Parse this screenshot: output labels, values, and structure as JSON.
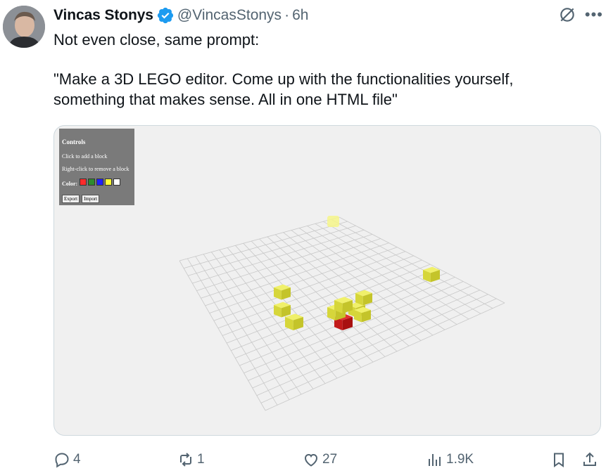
{
  "author": {
    "name": "Vincas Stonys",
    "handle": "@VincasStonys",
    "separator": "·",
    "time": "6h"
  },
  "tweet": {
    "line1": "Not even close, same prompt:",
    "line2": "\"Make a 3D LEGO editor. Come up with the functionalities yourself, something that makes sense. All in one HTML file\""
  },
  "editor": {
    "controls_title": "Controls",
    "hint_add": "Click to add a block",
    "hint_remove": "Right-click to remove a block",
    "color_label": "Color:",
    "colors": [
      "#ff2b2b",
      "#2e8b2e",
      "#1f1fff",
      "#ffff33",
      "#ffffff"
    ],
    "export_label": "Export",
    "import_label": "Import",
    "block_color": "#e8e84a",
    "highlight_color": "#d62020"
  },
  "stats": {
    "replies": "4",
    "reposts": "1",
    "likes": "27",
    "views": "1.9K"
  },
  "icons": [
    "verified-badge-icon",
    "grok-icon",
    "more-icon",
    "reply-icon",
    "repost-icon",
    "like-icon",
    "views-icon",
    "bookmark-icon",
    "share-icon"
  ],
  "accent": "#1d9bf0"
}
